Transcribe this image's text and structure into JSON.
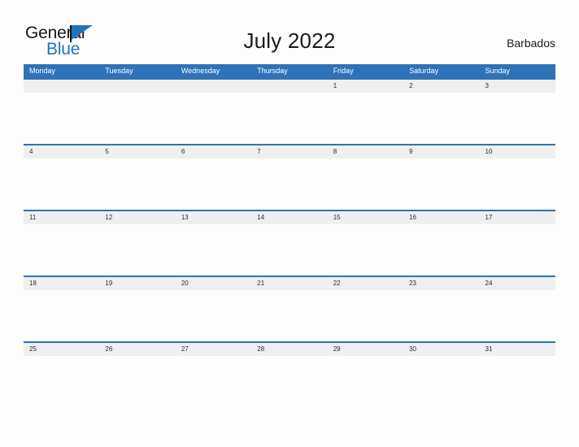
{
  "logo": {
    "word_one": "General",
    "word_two": "Blue",
    "flag_icon": "flag-triangle-icon",
    "brand_blue": "#1f73bd",
    "brand_dark": "#16181a"
  },
  "header": {
    "title": "July 2022",
    "locale": "Barbados"
  },
  "calendar": {
    "header_bg": "#2e73b8",
    "date_strip_bg": "#efefef",
    "body_bg": "#fdfdfd",
    "day_names": [
      "Monday",
      "Tuesday",
      "Wednesday",
      "Thursday",
      "Friday",
      "Saturday",
      "Sunday"
    ],
    "weeks": [
      {
        "dates": [
          "",
          "",
          "",
          "",
          "1",
          "2",
          "3"
        ]
      },
      {
        "dates": [
          "4",
          "5",
          "6",
          "7",
          "8",
          "9",
          "10"
        ]
      },
      {
        "dates": [
          "11",
          "12",
          "13",
          "14",
          "15",
          "16",
          "17"
        ]
      },
      {
        "dates": [
          "18",
          "19",
          "20",
          "21",
          "22",
          "23",
          "24"
        ]
      },
      {
        "dates": [
          "25",
          "26",
          "27",
          "28",
          "29",
          "30",
          "31"
        ]
      }
    ]
  }
}
